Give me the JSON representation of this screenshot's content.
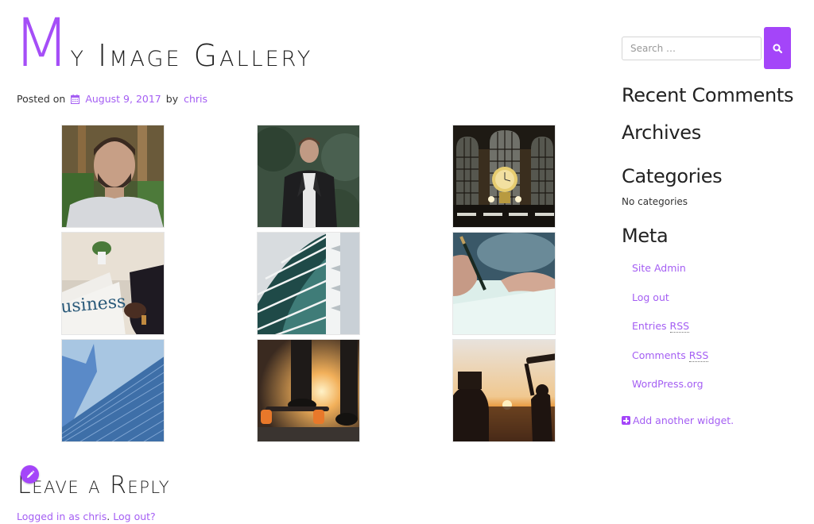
{
  "post": {
    "title_first_letter": "M",
    "title_rest": "y Image Gallery",
    "posted_on_label": "Posted on",
    "date": "August 9, 2017",
    "by_label": "by",
    "author": "chris"
  },
  "gallery": {
    "images": [
      {
        "alt": "Portrait of bearded man in grey shirt",
        "palette": [
          "#3b4a2a",
          "#6b7a4a",
          "#b59a82",
          "#d8d8dc"
        ]
      },
      {
        "alt": "Man in black leather jacket in forest",
        "palette": [
          "#2e4030",
          "#4a5e48",
          "#1d1d1f",
          "#e7e7e7"
        ]
      },
      {
        "alt": "Grand Central clock",
        "palette": [
          "#1e1a14",
          "#5a4a2a",
          "#d8c070",
          "#aaa9a0"
        ]
      },
      {
        "alt": "Businessman reading newspaper",
        "palette": [
          "#e8e1d6",
          "#cfc8bc",
          "#2a2420",
          "#2f6d80"
        ]
      },
      {
        "alt": "Glass building facade",
        "palette": [
          "#dce0e4",
          "#1f4e4e",
          "#5a9a9a",
          "#ffffff"
        ]
      },
      {
        "alt": "Hand writing with pen",
        "palette": [
          "#2a4a5a",
          "#cfe6e6",
          "#b08a78",
          "#dff2ef"
        ]
      },
      {
        "alt": "Blue skyscrapers",
        "palette": [
          "#9cc0e0",
          "#3a6aa8",
          "#5a8ac0",
          "#2c5488"
        ]
      },
      {
        "alt": "Skateboarder at sunset",
        "palette": [
          "#1a1614",
          "#f2b860",
          "#e07a2a",
          "#3a3430"
        ]
      },
      {
        "alt": "Silhouettes at sunset holding skateboard and camera",
        "palette": [
          "#e6ded6",
          "#f0a040",
          "#2a1a14",
          "#c06a2a"
        ]
      }
    ]
  },
  "sidebar": {
    "search": {
      "placeholder": "Search …",
      "button_icon": "search-icon"
    },
    "widgets": {
      "recent_comments": "Recent Comments",
      "archives": "Archives",
      "categories": "Categories",
      "no_categories": "No categories",
      "meta": "Meta"
    },
    "meta_links": [
      {
        "label": "Site Admin"
      },
      {
        "label": "Log out"
      },
      {
        "label": "Entries",
        "abbr": "RSS"
      },
      {
        "label": "Comments",
        "abbr": "RSS"
      },
      {
        "label": "WordPress.org"
      }
    ],
    "add_widget": "Add another widget."
  },
  "reply": {
    "title": "Leave a Reply",
    "logged_in_text": "Logged in as chris",
    "separator": ".",
    "logout_text": "Log out?"
  },
  "colors": {
    "accent": "#a445f9",
    "link": "#a45ef3",
    "text": "#222222"
  }
}
